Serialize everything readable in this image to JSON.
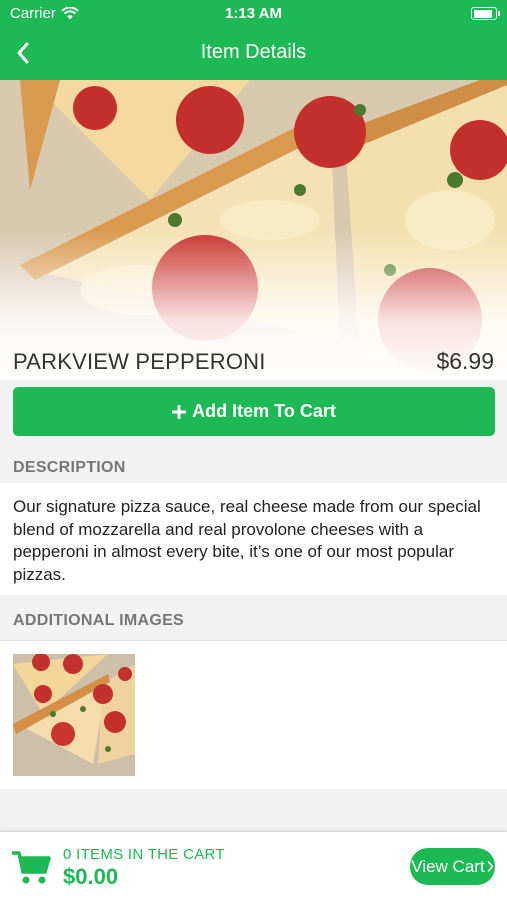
{
  "status_bar": {
    "carrier": "Carrier",
    "time": "1:13 AM",
    "battery_level": 0.9
  },
  "nav": {
    "title": "Item Details",
    "back_icon": "chevron-left-icon"
  },
  "item": {
    "name": "PARKVIEW PEPPERONI",
    "price": "$6.99",
    "add_button_label": "Add Item To Cart",
    "add_button_icon": "plus-icon"
  },
  "description": {
    "header": "DESCRIPTION",
    "text": "Our signature pizza sauce, real cheese made from our special blend of mozzarella and real provolone cheeses with a pepperoni in almost every bite, it’s one of our most popular pizzas."
  },
  "additional_images": {
    "header": "ADDITIONAL IMAGES",
    "count": 1
  },
  "cart": {
    "count_text": "0 ITEMS IN THE CART",
    "total": "$0.00",
    "view_cart_label": "View Cart",
    "icon": "shopping-cart-icon"
  },
  "colors": {
    "brand_green": "#1db954",
    "section_bg": "#f2f2f2",
    "muted_text": "#777777"
  }
}
